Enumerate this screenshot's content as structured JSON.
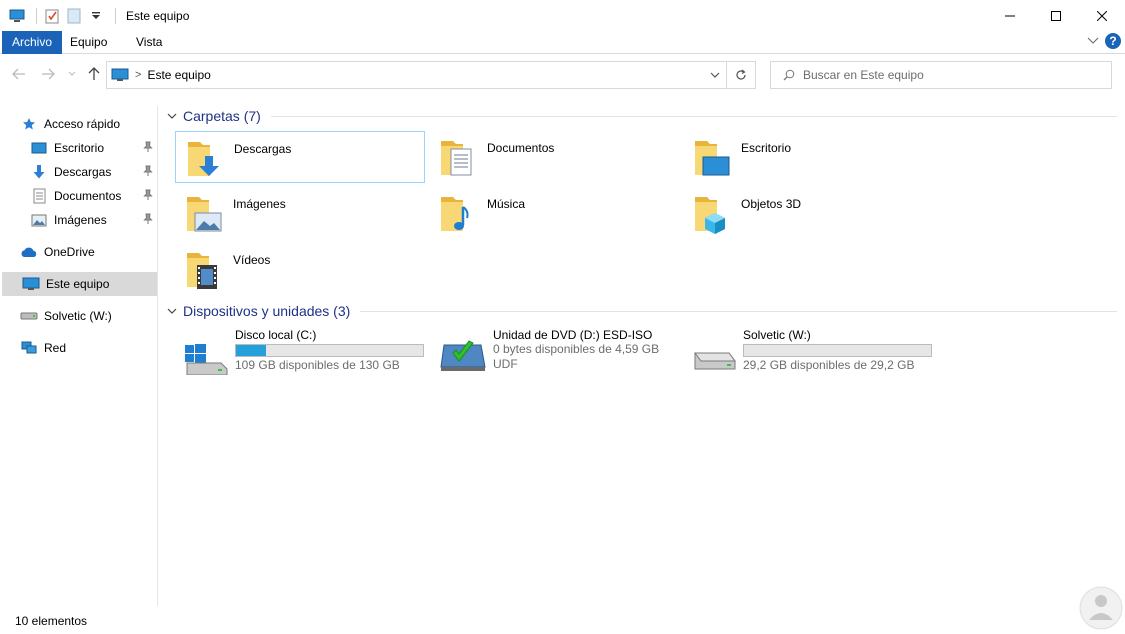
{
  "window": {
    "title": "Este equipo"
  },
  "ribbon": {
    "tabs": [
      "Archivo",
      "Equipo",
      "Vista"
    ],
    "help_label": "?"
  },
  "address": {
    "path": "Este equipo",
    "separator": ">"
  },
  "search": {
    "placeholder": "Buscar en Este equipo"
  },
  "sidebar": {
    "items": [
      {
        "label": "Acceso rápido",
        "icon": "star-icon"
      },
      {
        "label": "Escritorio",
        "icon": "desktop-folder-icon",
        "pinned": true
      },
      {
        "label": "Descargas",
        "icon": "download-arrow-icon",
        "pinned": true
      },
      {
        "label": "Documentos",
        "icon": "document-icon",
        "pinned": true
      },
      {
        "label": "Imágenes",
        "icon": "pictures-icon",
        "pinned": true
      },
      {
        "label": "OneDrive",
        "icon": "cloud-icon"
      },
      {
        "label": "Este equipo",
        "icon": "computer-icon",
        "selected": true
      },
      {
        "label": "Solvetic (W:)",
        "icon": "drive-icon"
      },
      {
        "label": "Red",
        "icon": "network-icon"
      }
    ]
  },
  "folders": {
    "header": "Carpetas (7)",
    "items": [
      {
        "label": "Descargas",
        "icon": "downloads-folder-icon"
      },
      {
        "label": "Documentos",
        "icon": "documents-folder-icon"
      },
      {
        "label": "Escritorio",
        "icon": "desktop-folder-icon"
      },
      {
        "label": "Imágenes",
        "icon": "pictures-folder-icon"
      },
      {
        "label": "Música",
        "icon": "music-folder-icon"
      },
      {
        "label": "Objetos 3D",
        "icon": "3d-objects-folder-icon"
      },
      {
        "label": "Vídeos",
        "icon": "videos-folder-icon"
      }
    ]
  },
  "devices": {
    "header": "Dispositivos y unidades (3)",
    "items": [
      {
        "name": "Disco local (C:)",
        "detail": "109 GB disponibles de 130 GB",
        "used_fraction": 0.16,
        "icon": "windows-drive-icon"
      },
      {
        "name": "Unidad de DVD (D:) ESD-ISO",
        "detail": "0 bytes disponibles de 4,59 GB",
        "extra": "UDF",
        "icon": "dvd-drive-icon"
      },
      {
        "name": "Solvetic (W:)",
        "detail": "29,2 GB disponibles de 29,2 GB",
        "used_fraction": 0.0,
        "icon": "drive-icon"
      }
    ]
  },
  "status": {
    "text": "10 elementos"
  },
  "colors": {
    "accent": "#1a63b8",
    "folder": "#f8d775",
    "bar_fill": "#26a0da",
    "header_text": "#1e3287"
  }
}
